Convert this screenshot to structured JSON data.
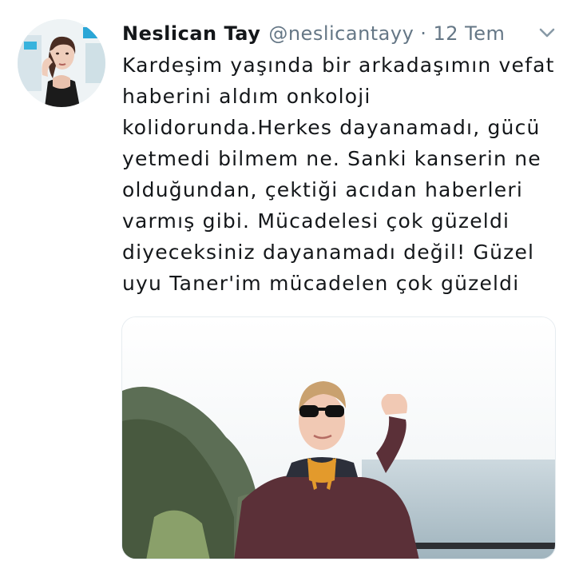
{
  "tweet": {
    "author": {
      "display_name": "Neslican Tay",
      "handle": "@neslicantayy"
    },
    "separator": "·",
    "date": "12 Tem",
    "text_lines": [
      "Kardeşim yaşında bir arkadaşımın vefat",
      "haberini aldım onkoloji",
      "kolidorunda.Herkes dayanamadı, gücü",
      "yetmedi bilmem ne. Sanki kanserin ne",
      "olduğundan, çektiği acıdan haberleri",
      "varmış gibi. Mücadelesi çok güzeldi",
      "diyeceksiniz dayanamadı değil! Güzel",
      "uyu Taner'im mücadelen çok güzeldi"
    ],
    "icons": {
      "menu": "chevron-down-icon"
    },
    "colors": {
      "text": "#14171a",
      "secondary": "#657786"
    }
  }
}
